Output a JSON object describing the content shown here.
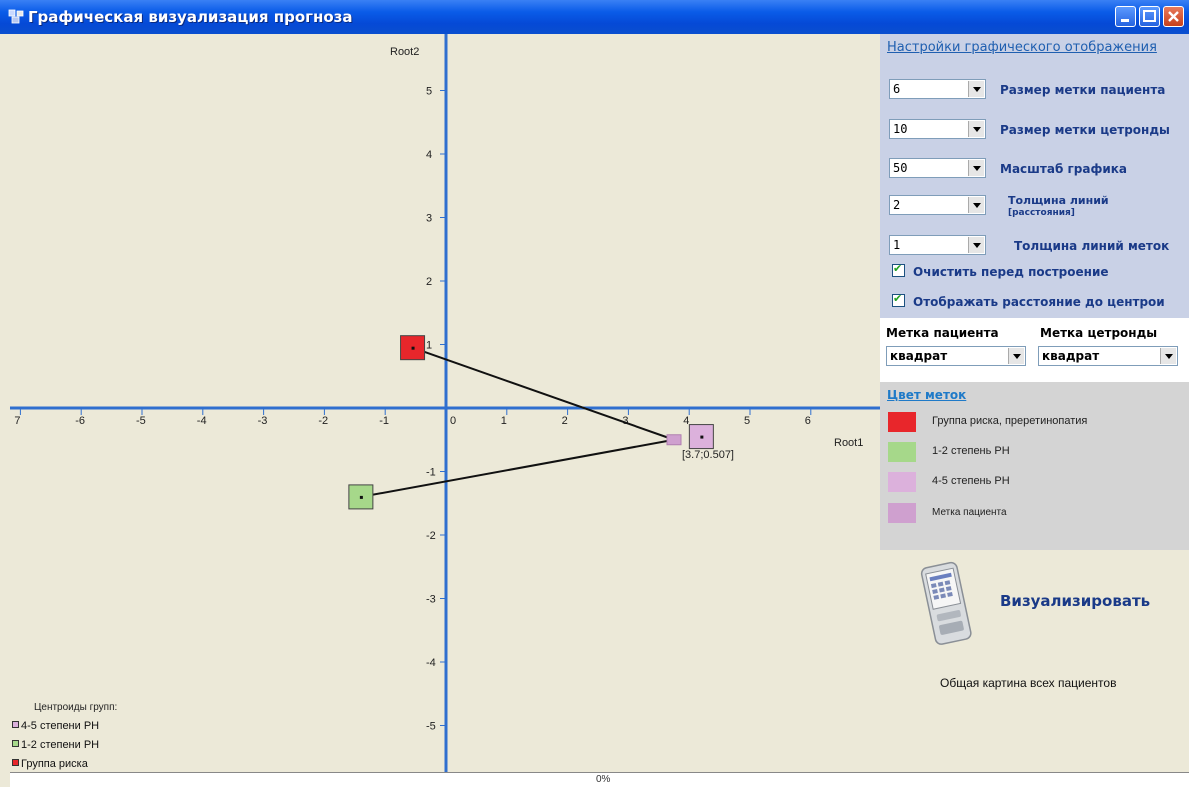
{
  "window": {
    "title": "Графическая визуализация прогноза",
    "buttons": [
      "minimize",
      "maximize",
      "close"
    ],
    "icon": "app-window-icon"
  },
  "settings": {
    "title": "Настройки графического отображения",
    "rows": [
      {
        "value": "6",
        "label": "Размер метки пациента"
      },
      {
        "value": "10",
        "label": "Размер метки цетронды"
      },
      {
        "value": "50",
        "label": "Масштаб графика"
      },
      {
        "value": "2",
        "label": "Толщина линий",
        "sublabel": "[расстояния]"
      },
      {
        "value": "1",
        "label": "Толщина линий меток"
      }
    ],
    "checks": [
      {
        "label": "Очистить перед построение",
        "checked": true
      },
      {
        "label": "Отображать расстояние до центрои",
        "checked": true
      }
    ]
  },
  "marks": {
    "patient_label": "Метка пациента",
    "centroid_label": "Метка цетронды",
    "patient_value": "квадрат",
    "centroid_value": "квадрат"
  },
  "colors": {
    "title": "Цвет меток",
    "items": [
      {
        "label": "Группа риска, преретинопатия",
        "color": "#e8262b"
      },
      {
        "label": "1-2 степень РН",
        "color": "#a6d88a"
      },
      {
        "label": "4-5 степень РН",
        "color": "#dcb1dc"
      },
      {
        "label": "Метка пациента",
        "color": "#cfa0cf"
      }
    ]
  },
  "actions": {
    "visualize_label": "Визуализировать",
    "overall_label": "Общая картина всех пациентов"
  },
  "status": {
    "progress": "0%"
  },
  "chart_data": {
    "type": "scatter",
    "xlabel": "Root1",
    "ylabel": "Root2",
    "xlim": [
      -7,
      6.7
    ],
    "ylim": [
      -5.8,
      5.8
    ],
    "x_ticks": [
      -7,
      -6,
      -5,
      -4,
      -3,
      -2,
      -1,
      0,
      1,
      2,
      3,
      4,
      5,
      6
    ],
    "y_ticks": [
      -5,
      -4,
      -3,
      -2,
      -1,
      1,
      2,
      3,
      4,
      5
    ],
    "tick_labels_x": [
      "7",
      "-6",
      "-5",
      "-4",
      "-3",
      "-2",
      "-1",
      "0",
      "1",
      "2",
      "3",
      "4",
      "5",
      "6"
    ],
    "tick_labels_y": [
      "-5",
      "-4",
      "-3",
      "-2",
      "-1",
      "1",
      "2",
      "3",
      "4",
      "5"
    ],
    "centroids": [
      {
        "name": "Группа риска",
        "x": -0.55,
        "y": 0.95,
        "color": "#e8262b"
      },
      {
        "name": "1-2 степени РН",
        "x": -1.4,
        "y": -1.4,
        "color": "#a6d88a"
      },
      {
        "name": "4-5 степени РН",
        "x": 4.2,
        "y": -0.45,
        "color": "#dcb1dc"
      }
    ],
    "patient": {
      "x": 3.75,
      "y": -0.5,
      "label": "[3.7;0.507]",
      "color": "#cfa0cf"
    },
    "lines": [
      {
        "from": [
          -0.55,
          0.95
        ],
        "to": [
          3.75,
          -0.5
        ]
      },
      {
        "from": [
          -1.4,
          -1.4
        ],
        "to": [
          3.75,
          -0.5
        ]
      }
    ],
    "legend_title": "Центроиды групп:",
    "legend": [
      {
        "label": "4-5 степени РН",
        "color": "#dcb1dc"
      },
      {
        "label": "1-2 степени РН",
        "color": "#a6d88a"
      },
      {
        "label": "Группа риска",
        "color": "#e8262b"
      }
    ]
  }
}
